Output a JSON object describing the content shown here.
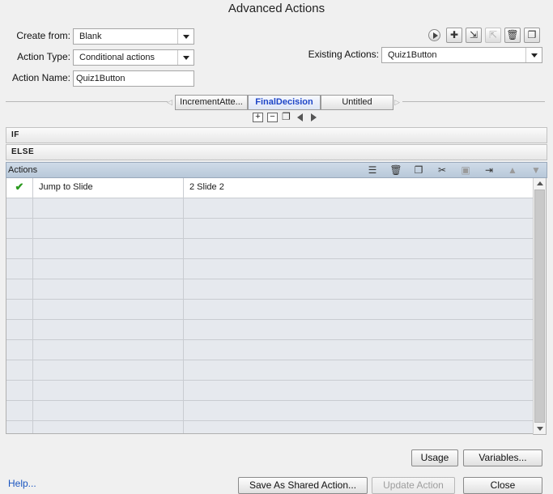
{
  "window": {
    "title": "Advanced Actions"
  },
  "form": {
    "create_from_label": "Create from:",
    "create_from_value": "Blank",
    "action_type_label": "Action Type:",
    "action_type_value": "Conditional actions",
    "action_name_label": "Action Name:",
    "action_name_value": "Quiz1Button",
    "existing_actions_label": "Existing Actions:",
    "existing_actions_value": "Quiz1Button"
  },
  "toolbar": {
    "icons": [
      "preview-icon",
      "add-icon",
      "import-icon",
      "export-icon",
      "delete-icon",
      "duplicate-icon"
    ]
  },
  "decision_tabs": [
    "IncrementAtte...",
    "FinalDecision",
    "Untitled"
  ],
  "decision_controls": {
    "add": "+",
    "remove": "−"
  },
  "sections": {
    "if_label": "IF",
    "else_label": "ELSE",
    "actions_label": "Actions"
  },
  "actions_rows": [
    {
      "checked": true,
      "action": "Jump to Slide",
      "target": "2 Slide 2"
    }
  ],
  "buttons": {
    "usage": "Usage",
    "variables": "Variables...",
    "help": "Help...",
    "save_shared": "Save As Shared Action...",
    "update": "Update Action",
    "close": "Close"
  },
  "colors": {
    "active_tab_text": "#1e46c8",
    "actions_header_bg": "#c3d1e0",
    "check": "#2b9a1f",
    "link": "#1a55c0"
  }
}
